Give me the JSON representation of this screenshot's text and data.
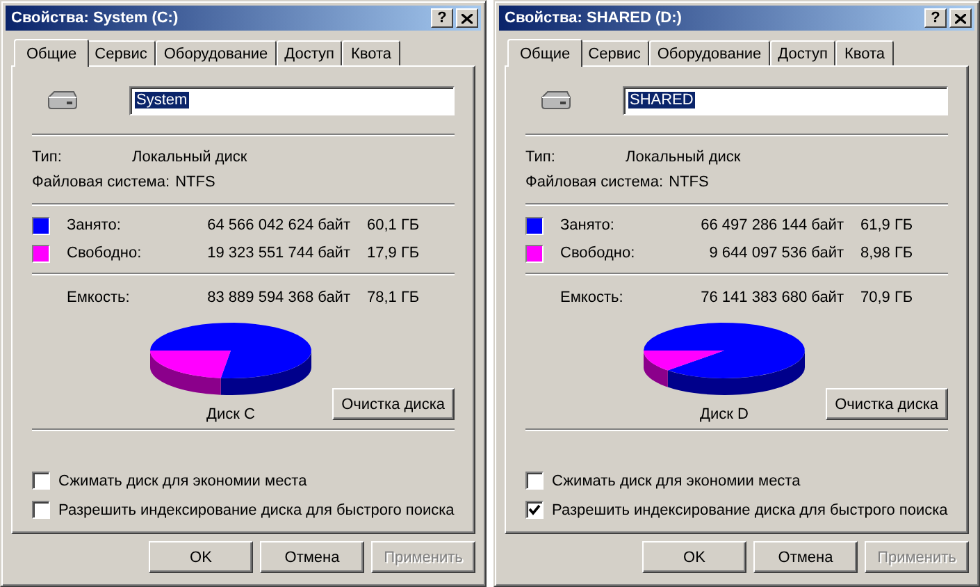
{
  "windows": [
    {
      "title": "Свойства: System (C:)",
      "help_label": "?",
      "tabs": [
        {
          "label": "Общие",
          "selected": true
        },
        {
          "label": "Сервис",
          "selected": false
        },
        {
          "label": "Оборудование",
          "selected": false
        },
        {
          "label": "Доступ",
          "selected": false
        },
        {
          "label": "Квота",
          "selected": false
        }
      ],
      "name_field": {
        "value": "System",
        "value_selected": true
      },
      "info": [
        {
          "label": "Тип:",
          "value": "Локальный диск"
        },
        {
          "label": "Файловая система:",
          "value": "NTFS"
        }
      ],
      "space": [
        {
          "label": "Занято:",
          "bytes": "64 566 042 624 байт",
          "size": "60,1 ГБ",
          "color": "#0000ff"
        },
        {
          "label": "Свободно:",
          "bytes": "19 323 551 744 байт",
          "size": "17,9 ГБ",
          "color": "#ff00ff"
        }
      ],
      "capacity": {
        "label": "Емкость:",
        "bytes": "83 889 594 368 байт",
        "size": "78,1 ГБ"
      },
      "usage": {
        "caption": "Диск C"
      },
      "cleanup_button": "Очистка диска",
      "options": [
        {
          "label": "Сжимать диск для экономии места",
          "checked": false
        },
        {
          "label": "Разрешить индексирование диска для быстрого поиска",
          "checked": false
        }
      ],
      "buttons": [
        {
          "label": "OK",
          "disabled": false
        },
        {
          "label": "Отмена",
          "disabled": false
        },
        {
          "label": "Применить",
          "disabled": true
        }
      ]
    },
    {
      "title": "Свойства: SHARED (D:)",
      "help_label": "?",
      "tabs": [
        {
          "label": "Общие",
          "selected": true
        },
        {
          "label": "Сервис",
          "selected": false
        },
        {
          "label": "Оборудование",
          "selected": false
        },
        {
          "label": "Доступ",
          "selected": false
        },
        {
          "label": "Квота",
          "selected": false
        }
      ],
      "name_field": {
        "value": "SHARED",
        "value_selected": true
      },
      "info": [
        {
          "label": "Тип:",
          "value": "Локальный диск"
        },
        {
          "label": "Файловая система:",
          "value": "NTFS"
        }
      ],
      "space": [
        {
          "label": "Занято:",
          "bytes": "66 497 286 144 байт",
          "size": "61,9 ГБ",
          "color": "#0000ff"
        },
        {
          "label": "Свободно:",
          "bytes": "9 644 097 536 байт",
          "size": "8,98 ГБ",
          "color": "#ff00ff"
        }
      ],
      "capacity": {
        "label": "Емкость:",
        "bytes": "76 141 383 680 байт",
        "size": "70,9 ГБ"
      },
      "usage": {
        "caption": "Диск D"
      },
      "cleanup_button": "Очистка диска",
      "options": [
        {
          "label": "Сжимать диск для экономии места",
          "checked": false
        },
        {
          "label": "Разрешить индексирование диска для быстрого поиска",
          "checked": true
        }
      ],
      "buttons": [
        {
          "label": "OK",
          "disabled": false
        },
        {
          "label": "Отмена",
          "disabled": false
        },
        {
          "label": "Применить",
          "disabled": true
        }
      ]
    }
  ]
}
